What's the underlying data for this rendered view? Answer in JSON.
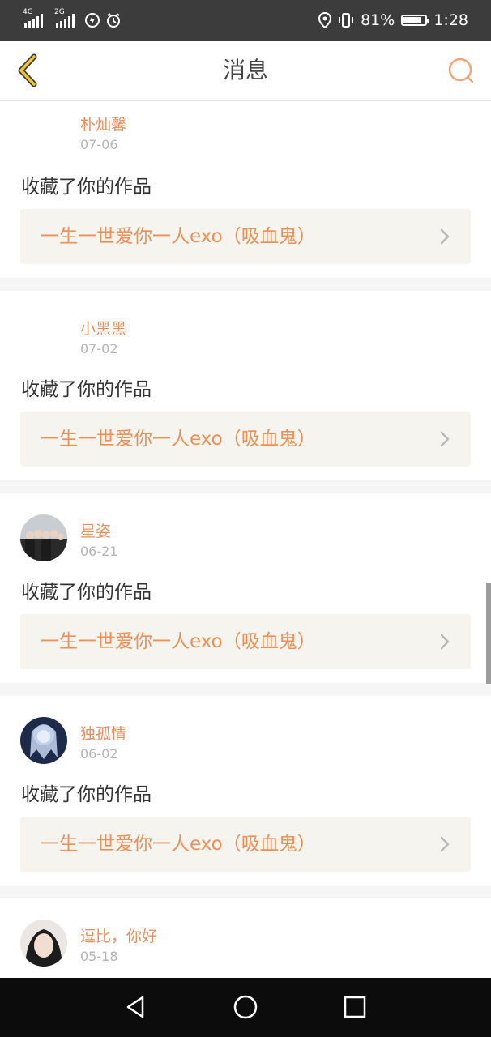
{
  "status_bar": {
    "network_1": "4G",
    "network_2": "2G",
    "battery_percent": "81%",
    "battery_level": 0.81,
    "time": "1:28"
  },
  "header": {
    "title": "消息",
    "accent_color": "#e98f5b"
  },
  "messages": [
    {
      "user": "朴灿馨",
      "date": "07-06",
      "action": "收藏了你的作品",
      "work_title": "一生一世爱你一人exo（吸血鬼）",
      "has_avatar": false
    },
    {
      "user": "小黑黑",
      "date": "07-02",
      "action": "收藏了你的作品",
      "work_title": "一生一世爱你一人exo（吸血鬼）",
      "has_avatar": false
    },
    {
      "user": "星姿",
      "date": "06-21",
      "action": "收藏了你的作品",
      "work_title": "一生一世爱你一人exo（吸血鬼）",
      "has_avatar": true
    },
    {
      "user": "独孤情",
      "date": "06-02",
      "action": "收藏了你的作品",
      "work_title": "一生一世爱你一人exo（吸血鬼）",
      "has_avatar": true
    },
    {
      "user": "逗比，你好",
      "date": "05-18",
      "has_avatar": true
    }
  ],
  "icons": {
    "back": "chevron-left-icon",
    "search": "search-icon",
    "nav_back": "triangle-back-icon",
    "nav_home": "circle-home-icon",
    "nav_recent": "square-recent-icon"
  }
}
